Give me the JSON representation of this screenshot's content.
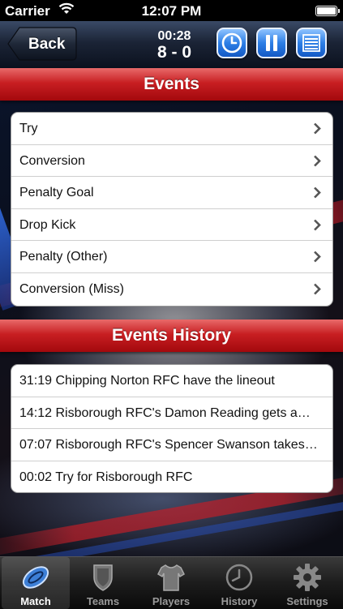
{
  "status": {
    "carrier": "Carrier",
    "time": "12:07 PM"
  },
  "nav": {
    "back_label": "Back",
    "clock": "00:28",
    "score": "8 - 0"
  },
  "events": {
    "header": "Events",
    "items": [
      "Try",
      "Conversion",
      "Penalty Goal",
      "Drop Kick",
      "Penalty (Other)",
      "Conversion (Miss)"
    ]
  },
  "history": {
    "header": "Events History",
    "items": [
      "31:19 Chipping Norton RFC have the lineout",
      "14:12 Risborough RFC's Damon Reading gets a…",
      "07:07 Risborough RFC's Spencer Swanson takes…",
      "00:02 Try for Risborough RFC"
    ]
  },
  "tabs": [
    "Match",
    "Teams",
    "Players",
    "History",
    "Settings"
  ],
  "active_tab": "Match",
  "colors": {
    "header_red": "#c81f22",
    "nav_button_blue": "#2d7fe6"
  },
  "icons": [
    "wifi-icon",
    "battery-icon",
    "back-arrow",
    "clock-icon",
    "pause-icon",
    "list-icon",
    "chevron-right-icon",
    "rugby-ball-icon",
    "shield-icon",
    "jersey-icon",
    "history-clock-icon",
    "gear-icon"
  ]
}
